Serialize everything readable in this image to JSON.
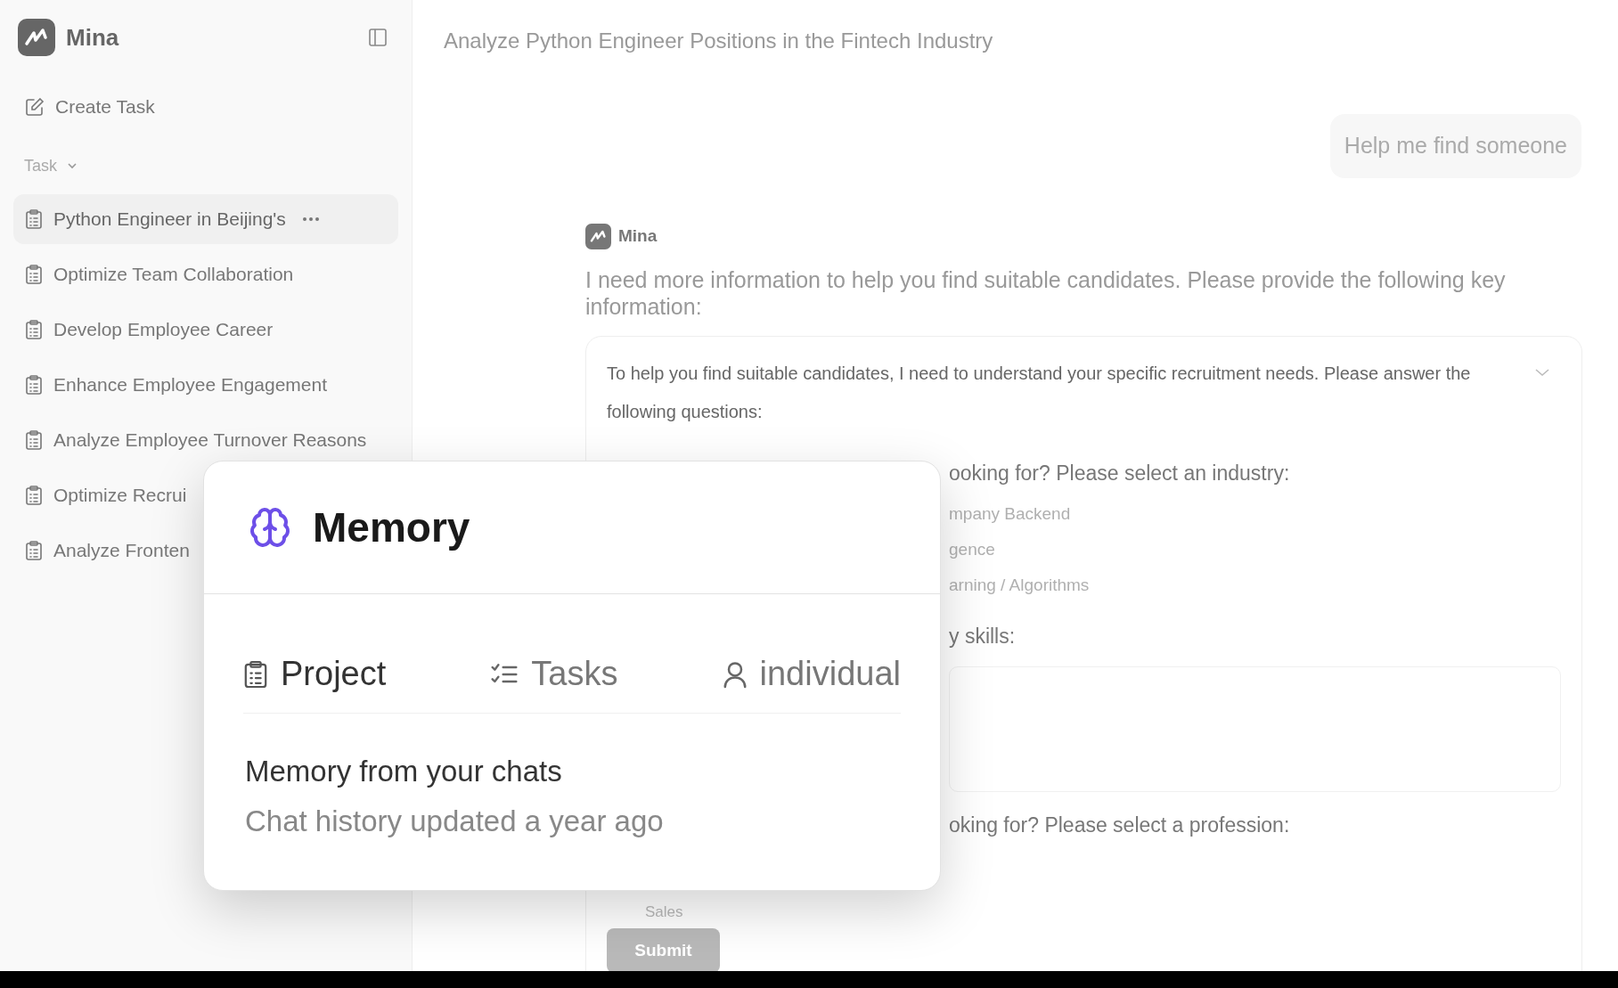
{
  "sidebar": {
    "brand": "Mina",
    "create_task": "Create Task",
    "section": {
      "label": "Task",
      "expanded": true
    },
    "items": [
      {
        "label": "Python Engineer in Beijing's",
        "selected": true
      },
      {
        "label": "Optimize Team Collaboration",
        "selected": false
      },
      {
        "label": "Develop Employee Career",
        "selected": false
      },
      {
        "label": "Enhance Employee Engagement",
        "selected": false
      },
      {
        "label": "Analyze Employee Turnover Reasons",
        "selected": false
      },
      {
        "label": "Optimize Recrui",
        "selected": false
      },
      {
        "label": "Analyze Fronten",
        "selected": false
      }
    ]
  },
  "header": {
    "title": "Analyze Python Engineer Positions in the Fintech Industry"
  },
  "chat": {
    "user_message": "Help me find someone",
    "assistant": {
      "name": "Mina",
      "text": "I need more information to help you find suitable candidates. Please provide the following key information:",
      "card": {
        "expanded": true,
        "intro": "To help you find suitable candidates, I need to understand your specific recruitment needs. Please answer the following questions:",
        "blocks": [
          {
            "kind": "question",
            "text": "ooking for? Please select an industry:"
          },
          {
            "kind": "option",
            "text": "mpany Backend"
          },
          {
            "kind": "option",
            "text": "gence"
          },
          {
            "kind": "option",
            "text": "arning / Algorithms"
          },
          {
            "kind": "question",
            "text": "y skills:"
          },
          {
            "kind": "textarea"
          },
          {
            "kind": "question",
            "text": "oking for? Please select a profession:"
          },
          {
            "kind": "option_full",
            "text": "Sales"
          },
          {
            "kind": "button",
            "text": "Submit",
            "disabled": true
          }
        ]
      }
    }
  },
  "memory_popup": {
    "title": "Memory",
    "tabs": [
      {
        "label": "Project",
        "selected": true
      },
      {
        "label": "Tasks",
        "selected": false
      },
      {
        "label": "individual",
        "selected": false
      }
    ],
    "heading": "Memory from your chats",
    "subtitle": "Chat history updated a year ago"
  }
}
